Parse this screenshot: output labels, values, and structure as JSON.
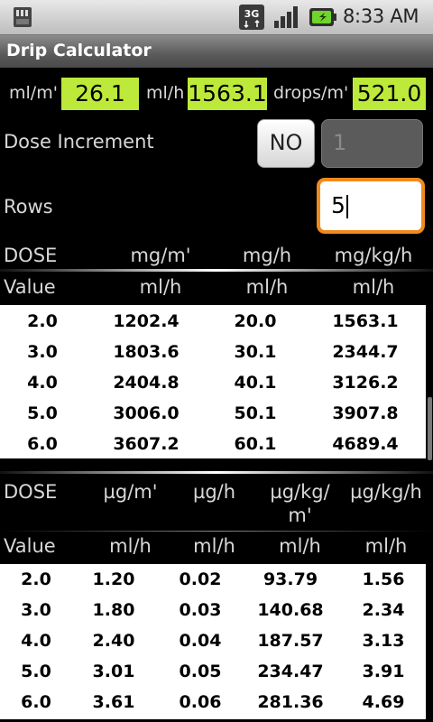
{
  "status_bar": {
    "time": "8:33 AM",
    "network": "3G",
    "icons": [
      "sd-card-icon",
      "3g-icon",
      "signal-icon",
      "battery-charging-icon"
    ]
  },
  "app": {
    "title": "Drip Calculator"
  },
  "rates": {
    "ml_m_label": "ml/m'",
    "ml_m_value": "26.1",
    "ml_h_label": "ml/h",
    "ml_h_value": "1563.1",
    "drops_label": "drops/m'",
    "drops_value": "521.0"
  },
  "dose_increment": {
    "label": "Dose Increment",
    "toggle_label": "NO",
    "value": "1"
  },
  "rows": {
    "label": "Rows",
    "value": "5"
  },
  "table_mg": {
    "header_top": [
      "DOSE",
      "mg/m'",
      "mg/h",
      "mg/kg/h"
    ],
    "header_bottom": [
      "Value",
      "ml/h",
      "ml/h",
      "ml/h"
    ],
    "rows": [
      [
        "2.0",
        "1202.4",
        "20.0",
        "1563.1"
      ],
      [
        "3.0",
        "1803.6",
        "30.1",
        "2344.7"
      ],
      [
        "4.0",
        "2404.8",
        "40.1",
        "3126.2"
      ],
      [
        "5.0",
        "3006.0",
        "50.1",
        "3907.8"
      ],
      [
        "6.0",
        "3607.2",
        "60.1",
        "4689.4"
      ]
    ]
  },
  "table_ug": {
    "header_top": [
      "DOSE",
      "µg/m'",
      "µg/h",
      "µg/kg/m'",
      "µg/kg/h"
    ],
    "header_top_c3_line1": "µg/kg/",
    "header_top_c3_line2": "m'",
    "header_bottom": [
      "Value",
      "ml/h",
      "ml/h",
      "ml/h",
      "ml/h"
    ],
    "rows": [
      [
        "2.0",
        "1.20",
        "0.02",
        "93.79",
        "1.56"
      ],
      [
        "3.0",
        "1.80",
        "0.03",
        "140.68",
        "2.34"
      ],
      [
        "4.0",
        "2.40",
        "0.04",
        "187.57",
        "3.13"
      ],
      [
        "5.0",
        "3.01",
        "0.05",
        "234.47",
        "3.91"
      ],
      [
        "6.0",
        "3.61",
        "0.06",
        "281.36",
        "4.69"
      ]
    ]
  }
}
